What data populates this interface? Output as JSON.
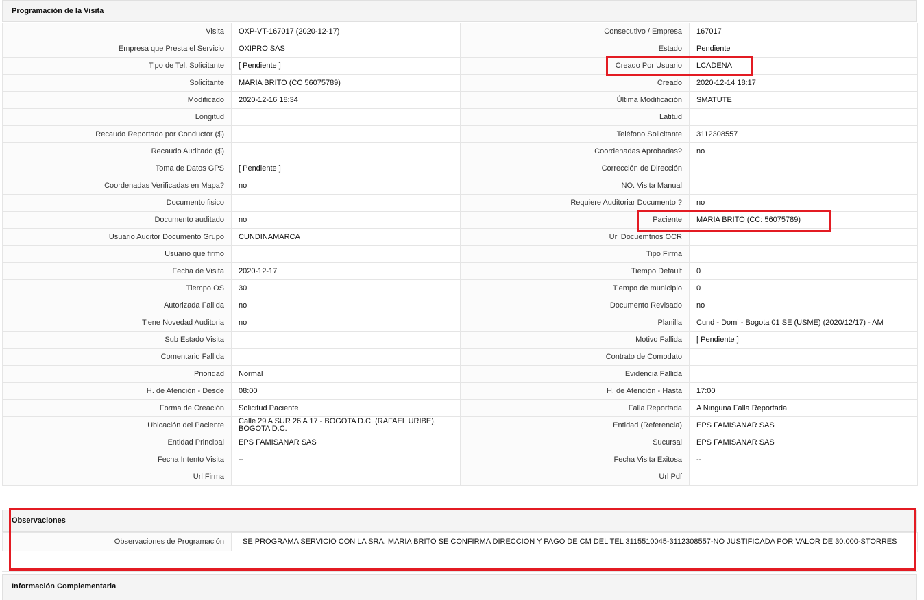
{
  "sections": {
    "programacion_title": "Programación de la Visita",
    "observaciones_title": "Observaciones",
    "info_title": "Información Complementaria"
  },
  "rows": [
    {
      "l1": "Visita",
      "v1": "OXP-VT-167017 (2020-12-17)",
      "l2": "Consecutivo / Empresa",
      "v2": "167017"
    },
    {
      "l1": "Empresa que Presta el Servicio",
      "v1": "OXIPRO SAS",
      "l2": "Estado",
      "v2": "Pendiente"
    },
    {
      "l1": "Tipo de Tel. Solicitante",
      "v1": "[ Pendiente ]",
      "l2": "Creado Por Usuario",
      "v2": "LCADENA"
    },
    {
      "l1": "Solicitante",
      "v1": "MARIA BRITO (CC 56075789)",
      "l2": "Creado",
      "v2": "2020-12-14 18:17"
    },
    {
      "l1": "Modificado",
      "v1": "2020-12-16 18:34",
      "l2": "Última Modificación",
      "v2": " SMATUTE"
    },
    {
      "l1": "Longitud",
      "v1": "",
      "l2": "Latitud",
      "v2": ""
    },
    {
      "l1": "Recaudo Reportado por Conductor ($)",
      "v1": "",
      "l2": "Teléfono Solicitante",
      "v2": "3112308557"
    },
    {
      "l1": "Recaudo Auditado ($)",
      "v1": "",
      "l2": "Coordenadas Aprobadas?",
      "v2": " no"
    },
    {
      "l1": "Toma de Datos GPS",
      "v1": "[ Pendiente ]",
      "l2": "Corrección de Dirección",
      "v2": ""
    },
    {
      "l1": "Coordenadas Verificadas en Mapa?",
      "v1": " no",
      "l2": "NO. Visita Manual",
      "v2": ""
    },
    {
      "l1": "Documento fisico",
      "v1": "",
      "l2": "Requiere Auditoriar Documento ?",
      "v2": " no"
    },
    {
      "l1": "Documento auditado",
      "v1": " no",
      "l2": "Paciente",
      "v2": "MARIA BRITO (CC: 56075789)"
    },
    {
      "l1": "Usuario Auditor Documento Grupo",
      "v1": "CUNDINAMARCA",
      "l2": "Url Docuemtnos OCR",
      "v2": ""
    },
    {
      "l1": "Usuario que firmo",
      "v1": "",
      "l2": "Tipo Firma",
      "v2": ""
    },
    {
      "l1": "Fecha de Visita",
      "v1": " 2020-12-17",
      "l2": "Tiempo Default",
      "v2": "0"
    },
    {
      "l1": "Tiempo OS",
      "v1": "30",
      "l2": "Tiempo de municipio",
      "v2": "0"
    },
    {
      "l1": "Autorizada Fallida",
      "v1": " no",
      "l2": "Documento Revisado",
      "v2": " no"
    },
    {
      "l1": "Tiene Novedad Auditoria",
      "v1": " no",
      "l2": "Planilla",
      "v2": "Cund - Domi - Bogota 01 SE (USME) (2020/12/17) - AM"
    },
    {
      "l1": "Sub Estado Visita",
      "v1": "",
      "l2": "Motivo Fallida",
      "v2": "[ Pendiente ]"
    },
    {
      "l1": "Comentario Fallida",
      "v1": "",
      "l2": "Contrato de Comodato",
      "v2": ""
    },
    {
      "l1": "Prioridad",
      "v1": "Normal",
      "l2": "Evidencia Fallida",
      "v2": ""
    },
    {
      "l1": "H. de Atención - Desde",
      "v1": "08:00",
      "l2": "H. de Atención - Hasta",
      "v2": "17:00"
    },
    {
      "l1": "Forma de Creación",
      "v1": "Solicitud Paciente",
      "l2": "Falla Reportada",
      "v2": "A Ninguna Falla Reportada"
    },
    {
      "l1": "Ubicación del Paciente",
      "v1": "Calle 29 A SUR 26 A 17 - BOGOTA D.C. (RAFAEL URIBE), BOGOTA D.C.",
      "l2": "Entidad (Referencia)",
      "v2": "EPS FAMISANAR SAS"
    },
    {
      "l1": "Entidad Principal",
      "v1": "EPS FAMISANAR SAS",
      "l2": "Sucursal",
      "v2": "EPS FAMISANAR SAS"
    },
    {
      "l1": "Fecha Intento Visita",
      "v1": " --",
      "l2": "Fecha Visita Exitosa",
      "v2": " --"
    },
    {
      "l1": "Url Firma",
      "v1": "",
      "l2": "Url Pdf",
      "v2": ""
    }
  ],
  "observaciones": {
    "label": "Observaciones de Programación",
    "value": "SE PROGRAMA SERVICIO CON LA SRA. MARIA BRITO SE CONFIRMA DIRECCION Y PAGO DE CM DEL TEL 3115510045-3112308557-NO JUSTIFICADA POR VALOR DE 30.000-STORRES"
  },
  "colors": {
    "highlight": "#e31b23",
    "header_bg": "#f4f4f4",
    "border": "#e5e5e5"
  }
}
